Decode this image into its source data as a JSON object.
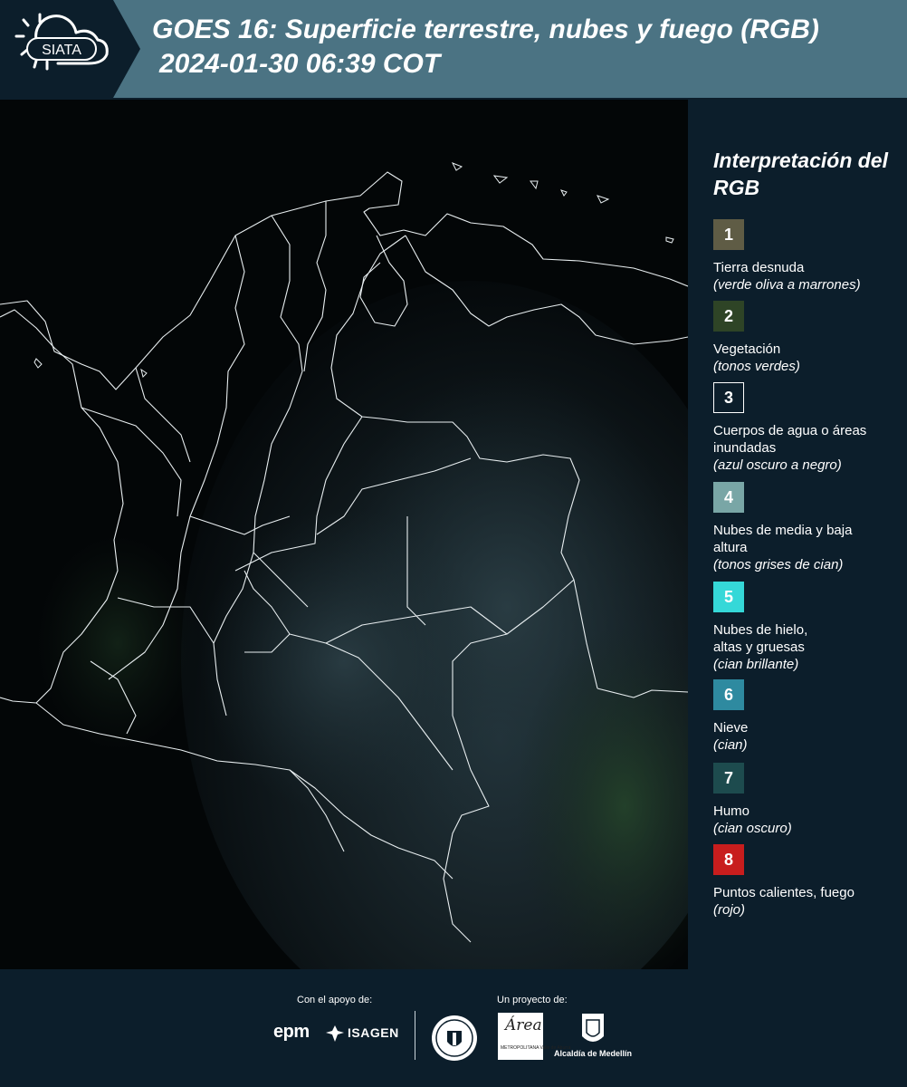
{
  "header": {
    "logo_text": "SIATA",
    "title_line1": "GOES 16: Superficie terrestre, nubes y fuego (RGB)",
    "title_line2": "2024-01-30 06:39 COT",
    "background_color": "#4b7383"
  },
  "legend": {
    "title": "Interpretación del RGB",
    "items": [
      {
        "number": "1",
        "label": "Tierra desnuda",
        "desc": "(verde oliva a marrones)",
        "color": "#5f5c45"
      },
      {
        "number": "2",
        "label": "Vegetación",
        "desc": "(tonos verdes)",
        "color": "#2e4426"
      },
      {
        "number": "3",
        "label": "Cuerpos de agua o áreas inundadas",
        "desc": "(azul oscuro a negro)",
        "color": "#0c1e2b"
      },
      {
        "number": "4",
        "label": "Nubes de media y baja altura",
        "desc": "(tonos grises de cian)",
        "color": "#79a6a6"
      },
      {
        "number": "5",
        "label": "Nubes de hielo, altas y gruesas",
        "desc": "(cian brillante)",
        "color": "#35d8d8"
      },
      {
        "number": "6",
        "label": "Nieve",
        "desc": "(cian)",
        "color": "#2e8aa0"
      },
      {
        "number": "7",
        "label": "Humo",
        "desc": "(cian oscuro)",
        "color": "#1d4b4e"
      },
      {
        "number": "8",
        "label": "Puntos calientes, fuego",
        "desc": "(rojo)",
        "color": "#c81d1d"
      }
    ]
  },
  "footer": {
    "support_label": "Con el apoyo de:",
    "project_label": "Un proyecto de:",
    "sponsor1": "epm",
    "sponsor2": "ISAGEN",
    "area_word": "Área",
    "area_sub": "METROPOLITANA Valle de Aburrá",
    "medellin": "Alcaldía de Medellín"
  }
}
